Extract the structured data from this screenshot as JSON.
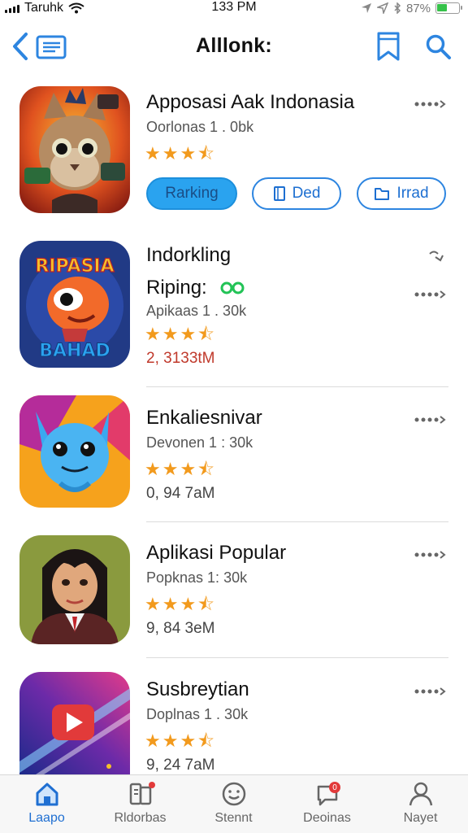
{
  "status": {
    "carrier": "Taruhk",
    "time": "133 PM",
    "battery": "87%"
  },
  "nav": {
    "title": "Alllonk:"
  },
  "apps": [
    {
      "name": "Apposasi Aak Indonasia",
      "sub": "Oorlonas 1 . 0bk",
      "stars": "★★★⯪",
      "meta": "",
      "buttons": [
        {
          "label": "Rarking"
        },
        {
          "label": "Ded"
        },
        {
          "label": "Irrad"
        }
      ]
    },
    {
      "name": "Indorkling",
      "sub2": "Riping:",
      "sub": "Apikaas 1 . 30k",
      "stars": "★★★⯪",
      "meta": "2, 3133tM",
      "icon_text_top": "RIPASIA",
      "icon_text_bottom": "BAHAD"
    },
    {
      "name": "Enkaliesnivar",
      "sub": "Devonen 1 : 30k",
      "stars": "★★★⯪",
      "meta": "0, 94 7aM"
    },
    {
      "name": "Aplikasi Popular",
      "sub": "Popknas 1: 30k",
      "stars": "★★★⯪",
      "meta": "9, 84 3eM"
    },
    {
      "name": "Susbreytian",
      "sub": "Doplnas 1 . 30k",
      "stars": "★★★⯪",
      "meta": "9, 24 7aM"
    }
  ],
  "tabs": [
    {
      "label": "Laapo",
      "icon": "home-icon",
      "active": true
    },
    {
      "label": "Rldorbas",
      "icon": "apps-icon"
    },
    {
      "label": "Stennt",
      "icon": "smile-icon"
    },
    {
      "label": "Deoinas",
      "icon": "chat-icon",
      "badge": "0"
    },
    {
      "label": "Nayet",
      "icon": "person-icon"
    }
  ],
  "colors": {
    "accent": "#2d85e0",
    "star": "#f29a1d",
    "meta_red": "#c0392b",
    "ping": "#22c356"
  }
}
